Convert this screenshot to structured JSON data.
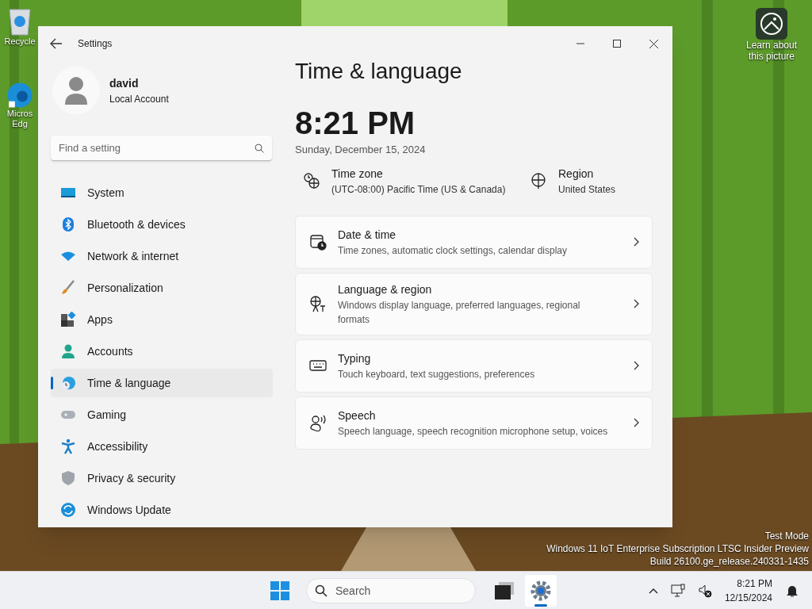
{
  "desktop": {
    "icons": [
      {
        "label": [
          "Recycle"
        ]
      },
      {
        "label": [
          "Micros",
          "Edg"
        ]
      }
    ],
    "spotlight": {
      "label": [
        "Learn about",
        "this picture"
      ]
    },
    "watermark": [
      "Test Mode",
      "Windows 11 IoT Enterprise Subscription LTSC Insider Preview",
      "Build 26100.ge_release.240331-1435"
    ]
  },
  "window": {
    "title": "Settings",
    "user": {
      "name": "david",
      "account": "Local Account"
    },
    "search": {
      "placeholder": "Find a setting"
    },
    "nav": [
      {
        "label": "System",
        "selected": false
      },
      {
        "label": "Bluetooth & devices",
        "selected": false
      },
      {
        "label": "Network & internet",
        "selected": false
      },
      {
        "label": "Personalization",
        "selected": false
      },
      {
        "label": "Apps",
        "selected": false
      },
      {
        "label": "Accounts",
        "selected": false
      },
      {
        "label": "Time & language",
        "selected": true
      },
      {
        "label": "Gaming",
        "selected": false
      },
      {
        "label": "Accessibility",
        "selected": false
      },
      {
        "label": "Privacy & security",
        "selected": false
      },
      {
        "label": "Windows Update",
        "selected": false
      }
    ],
    "page": {
      "heading": "Time & language",
      "clock": "8:21 PM",
      "date": "Sunday, December 15, 2024",
      "info": [
        {
          "title": "Time zone",
          "value": "(UTC-08:00) Pacific Time (US & Canada)"
        },
        {
          "title": "Region",
          "value": "United States"
        }
      ],
      "cards": [
        {
          "title": "Date & time",
          "subtitle": "Time zones, automatic clock settings, calendar display"
        },
        {
          "title": "Language & region",
          "subtitle": "Windows display language, preferred languages, regional formats"
        },
        {
          "title": "Typing",
          "subtitle": "Touch keyboard, text suggestions, preferences"
        },
        {
          "title": "Speech",
          "subtitle": "Speech language, speech recognition microphone setup, voices"
        }
      ]
    }
  },
  "taskbar": {
    "search": {
      "placeholder": "Search"
    },
    "apps": [
      {
        "selected": false
      },
      {
        "selected": true
      }
    ],
    "time": "8:21 PM",
    "date": "12/15/2024"
  }
}
